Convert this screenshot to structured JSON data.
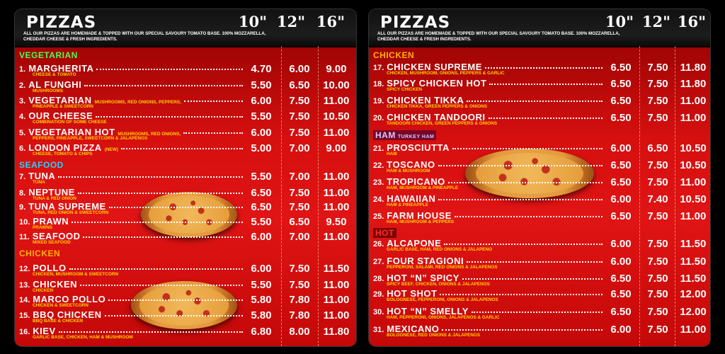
{
  "left_board": {
    "title": "PIZZAS",
    "sizes": [
      "10\"",
      "12\"",
      "16\""
    ],
    "description": "ALL OUR PIZZAS ARE HOMEMADE & TOPPED WITH OUR SPECIAL SAVOURY TOMATO BASE. 100% MOZZARELLA, CHEDDAR CHEESE & FRESH INGREDIENTS.",
    "categories": {
      "vegetarian": "VEGETARIAN",
      "seafood": "SEAFOOD",
      "chicken": "CHICKEN"
    },
    "items": [
      {
        "num": "1.",
        "name": "MARGHERITA",
        "inline": "",
        "desc": "CHEESE & TOMATO",
        "prices": [
          "4.70",
          "6.00",
          "9.00"
        ]
      },
      {
        "num": "2.",
        "name": "AL FUNGHI",
        "inline": "",
        "desc": "MUSHROOMS",
        "prices": [
          "5.50",
          "6.50",
          "10.00"
        ]
      },
      {
        "num": "3.",
        "name": "VEGETARIAN",
        "inline": "MUSHROOMS, RED ONIONS, PEPPERS,",
        "desc": "PINEAPPLE & SWEETCORN",
        "prices": [
          "6.00",
          "7.50",
          "11.00"
        ]
      },
      {
        "num": "4.",
        "name": "OUR CHEESE",
        "inline": "",
        "desc": "COMBINATION OF SOME CHEESE",
        "prices": [
          "5.50",
          "7.50",
          "10.50"
        ]
      },
      {
        "num": "5.",
        "name": "VEGETARIAN HOT",
        "inline": "MUSHROOMS, RED ONIONS,",
        "desc": "PEPPERS, PINEAPPLE, SWEETCORN & JALAPENOS",
        "prices": [
          "6.00",
          "7.50",
          "11.00"
        ]
      },
      {
        "num": "6.",
        "name": "LONDON PIZZA",
        "inline": "(NEW)",
        "desc": "CHEESE, TOMATO & CHIPS",
        "prices": [
          "5.00",
          "7.00",
          "9.00"
        ]
      },
      {
        "num": "7.",
        "name": "TUNA",
        "inline": "",
        "desc": "TUNA",
        "prices": [
          "5.50",
          "7.00",
          "11.00"
        ]
      },
      {
        "num": "8.",
        "name": "NEPTUNE",
        "inline": "",
        "desc": "TUNA & RED ONION",
        "prices": [
          "6.50",
          "7.50",
          "11.00"
        ]
      },
      {
        "num": "9.",
        "name": "TUNA SUPREME",
        "inline": "",
        "desc": "TUNA, RED ONION & SWEETCORN",
        "prices": [
          "6.50",
          "7.50",
          "11.00"
        ]
      },
      {
        "num": "10.",
        "name": "PRAWN",
        "inline": "",
        "desc": "PRAWNS",
        "prices": [
          "5.50",
          "6.50",
          "9.50"
        ]
      },
      {
        "num": "11.",
        "name": "SEAFOOD",
        "inline": "",
        "desc": "MIXED SEAFOOD",
        "prices": [
          "6.00",
          "7.00",
          "11.00"
        ]
      },
      {
        "num": "12.",
        "name": "POLLO",
        "inline": "",
        "desc": "CHICKEN, MUSHROOM & SWEETCORN",
        "prices": [
          "6.00",
          "7.50",
          "11.50"
        ]
      },
      {
        "num": "13.",
        "name": "CHICKEN",
        "inline": "",
        "desc": "CHICKEN",
        "prices": [
          "5.50",
          "7.50",
          "11.00"
        ]
      },
      {
        "num": "14.",
        "name": "MARCO POLLO",
        "inline": "",
        "desc": "CHICKEN & SWEETCORN",
        "prices": [
          "5.80",
          "7.80",
          "11.00"
        ]
      },
      {
        "num": "15.",
        "name": "BBQ CHICKEN",
        "inline": "",
        "desc": "BBQ BASE & CHICKEN",
        "prices": [
          "5.80",
          "7.80",
          "11.00"
        ]
      },
      {
        "num": "16.",
        "name": "KIEV",
        "inline": "",
        "desc": "GARLIC BASE, CHICKEN, HAM & MUSHROOM",
        "prices": [
          "6.80",
          "8.00",
          "11.80"
        ]
      }
    ]
  },
  "right_board": {
    "title": "PIZZAS",
    "sizes": [
      "10\"",
      "12\"",
      "16\""
    ],
    "description": "ALL OUR PIZZAS ARE HOMEMADE & TOPPED WITH OUR SPECIAL SAVOURY TOMATO BASE. 100% MOZZARELLA, CHEDDAR CHEESE & FRESH INGREDIENTS.",
    "categories": {
      "chicken": "CHICKEN",
      "ham": "HAM",
      "ham_note": "TURKEY HAM",
      "hot": "HOT"
    },
    "items": [
      {
        "num": "17.",
        "name": "CHICKEN SUPREME",
        "desc": "CHICKEN, MUSHROOM, ONIONS, PEPPERS & GARLIC",
        "prices": [
          "6.50",
          "7.50",
          "11.80"
        ]
      },
      {
        "num": "18.",
        "name": "SPICY CHICKEN HOT",
        "desc": "SPICY CHICKEN",
        "prices": [
          "6.50",
          "7.50",
          "11.80"
        ]
      },
      {
        "num": "19.",
        "name": "CHICKEN TIKKA",
        "desc": "CHICKEN TIKKA, GREEN PEPPERS & ONIONS",
        "prices": [
          "6.50",
          "7.50",
          "11.00"
        ]
      },
      {
        "num": "20.",
        "name": "CHICKEN TANDOORI",
        "desc": "TANDOORI CHICKEN, GREEN PEPPERS & ONIONS",
        "prices": [
          "6.50",
          "7.50",
          "11.00"
        ]
      },
      {
        "num": "21.",
        "name": "PROSCIUTTA",
        "desc": "HAM",
        "prices": [
          "6.00",
          "6.50",
          "10.50"
        ]
      },
      {
        "num": "22.",
        "name": "TOSCANO",
        "desc": "HAM & MUSHROOM",
        "prices": [
          "6.50",
          "7.50",
          "10.50"
        ]
      },
      {
        "num": "23.",
        "name": "TROPICANO",
        "desc": "HAM, MUSHROOM & PINEAPPLE",
        "prices": [
          "6.50",
          "7.50",
          "11.00"
        ]
      },
      {
        "num": "24.",
        "name": "HAWAIIAN",
        "desc": "HAM & PINEAPPLE",
        "prices": [
          "6.00",
          "7.40",
          "10.50"
        ]
      },
      {
        "num": "25.",
        "name": "FARM HOUSE",
        "desc": "HAM, MUSHROOM & PEPPERS",
        "prices": [
          "6.50",
          "7.50",
          "11.00"
        ]
      },
      {
        "num": "26.",
        "name": "ALCAPONE",
        "desc": "GARLIC BASE, HAM, RED ONIONS & JALAPENO",
        "prices": [
          "6.00",
          "7.50",
          "11.50"
        ]
      },
      {
        "num": "27.",
        "name": "FOUR STAGIONI",
        "desc": "PEPPERONI, SALAMI, RED ONIONS & JALAPENOS",
        "prices": [
          "6.00",
          "7.50",
          "11.50"
        ]
      },
      {
        "num": "28.",
        "name": "HOT “N” SPICY",
        "desc": "SPICY BEEF, CHICKEN, ONIONS & JALAPENOS",
        "prices": [
          "6.50",
          "7.50",
          "11.50"
        ]
      },
      {
        "num": "29.",
        "name": "HOT SHOT",
        "desc": "BOLOGNESE, PEPPERONI, ONIONS & JALAPENOS",
        "prices": [
          "6.50",
          "7.50",
          "12.00"
        ]
      },
      {
        "num": "30.",
        "name": "HOT “N” SMELLY",
        "desc": "HAM, PEPPERONI, ONIONS, JALAPENOS & GARLIC",
        "prices": [
          "6.50",
          "7.50",
          "12.00"
        ]
      },
      {
        "num": "31.",
        "name": "MEXICANO",
        "desc": "BOLOGNESE, RED ONIONS & JALAPENOS",
        "prices": [
          "6.00",
          "7.50",
          "11.00"
        ]
      }
    ]
  }
}
